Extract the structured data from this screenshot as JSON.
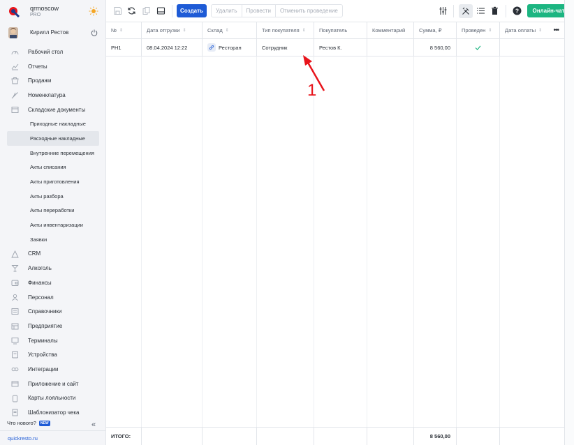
{
  "brand": {
    "name": "qrmoscow",
    "plan": "PRO"
  },
  "user": {
    "name": "Кирилл Рестов"
  },
  "sidebar": {
    "items": [
      {
        "label": "Рабочий стол",
        "icon": "dashboard-icon"
      },
      {
        "label": "Отчеты",
        "icon": "reports-icon"
      },
      {
        "label": "Продажи",
        "icon": "sales-icon"
      },
      {
        "label": "Номенклатура",
        "icon": "catalog-icon"
      },
      {
        "label": "Складские документы",
        "icon": "warehouse-docs-icon"
      }
    ],
    "sub_items": [
      "Приходные накладные",
      "Расходные накладные",
      "Внутренние перемещения",
      "Акты списания",
      "Акты приготовления",
      "Акты разбора",
      "Акты переработки",
      "Акты инвентаризации",
      "Заявки"
    ],
    "active_sub": "Расходные накладные",
    "items_after": [
      {
        "label": "CRM",
        "icon": "crm-icon"
      },
      {
        "label": "Алкоголь",
        "icon": "alcohol-icon"
      },
      {
        "label": "Финансы",
        "icon": "finance-icon"
      },
      {
        "label": "Персонал",
        "icon": "staff-icon"
      },
      {
        "label": "Справочники",
        "icon": "directories-icon"
      },
      {
        "label": "Предприятие",
        "icon": "enterprise-icon"
      },
      {
        "label": "Терминалы",
        "icon": "terminals-icon"
      },
      {
        "label": "Устройства",
        "icon": "devices-icon"
      },
      {
        "label": "Интеграции",
        "icon": "integrations-icon"
      },
      {
        "label": "Приложение и сайт",
        "icon": "app-site-icon"
      },
      {
        "label": "Карты лояльности",
        "icon": "loyalty-cards-icon"
      },
      {
        "label": "Шаблонизатор чека",
        "icon": "receipt-template-icon"
      }
    ],
    "whats_new": "Что нового?",
    "new_badge": "NEW",
    "site_link": "quickresto.ru"
  },
  "toolbar": {
    "create_label": "Создать",
    "delete_label": "Удалить",
    "post_label": "Провести",
    "unpost_label": "Отменить проведение",
    "chat_label": "Онлайн-чат"
  },
  "table": {
    "columns": [
      "№",
      "Дата отгрузки",
      "Склад",
      "Тип покупателя",
      "Покупатель",
      "Комментарий",
      "Сумма, ₽",
      "Проведен",
      "Дата оплаты"
    ],
    "rows": [
      {
        "number": "РН1",
        "ship_date": "08.04.2024 12:22",
        "warehouse": "Ресторан",
        "buyer_type": "Сотрудник",
        "buyer": "Рестов К.",
        "comment": "",
        "sum": "8 560,00",
        "posted": true,
        "pay_date": ""
      }
    ],
    "footer_label": "ИТОГО:",
    "footer_sum": "8 560,00"
  },
  "annotation": {
    "label": "1",
    "color": "#e8141b"
  },
  "colors": {
    "accent": "#1e5bd6",
    "chat": "#1cb581",
    "check": "#1cb581"
  }
}
